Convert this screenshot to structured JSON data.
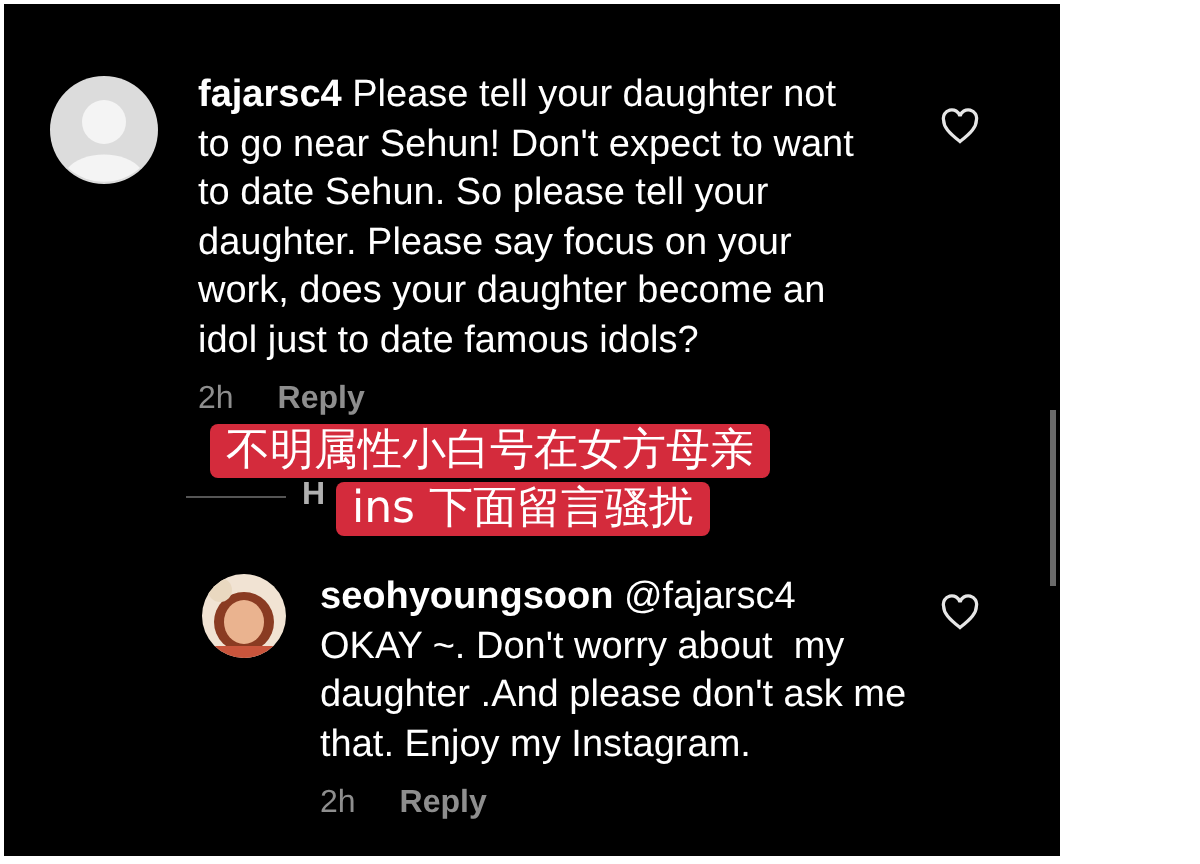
{
  "comments": [
    {
      "kind": "reply-parent",
      "avatar": {
        "kind": "placeholder"
      },
      "text": "**fajarsc4** Please tell your daughter not to go near Sehun! Don't expect to want to date Sehun. So please tell your daughter. Please say focus on your work, does your daughter become an idol just to date famous idols?",
      "time": "2h",
      "reply_label": "Reply",
      "liked": false
    },
    {
      "kind": "nested",
      "header": "**seohyoungsoon** @fajarsc4",
      "text": "OKAY ~. Don't worry about  my daughter .And please don't ask me that. Enjoy my Instagram.",
      "time": "2h",
      "reply_label": "Reply",
      "liked": false
    }
  ],
  "replies_toggle": "H",
  "caption_lines": [
    "不明属性小白号在女方母亲",
    "ins 下面留言骚扰"
  ]
}
